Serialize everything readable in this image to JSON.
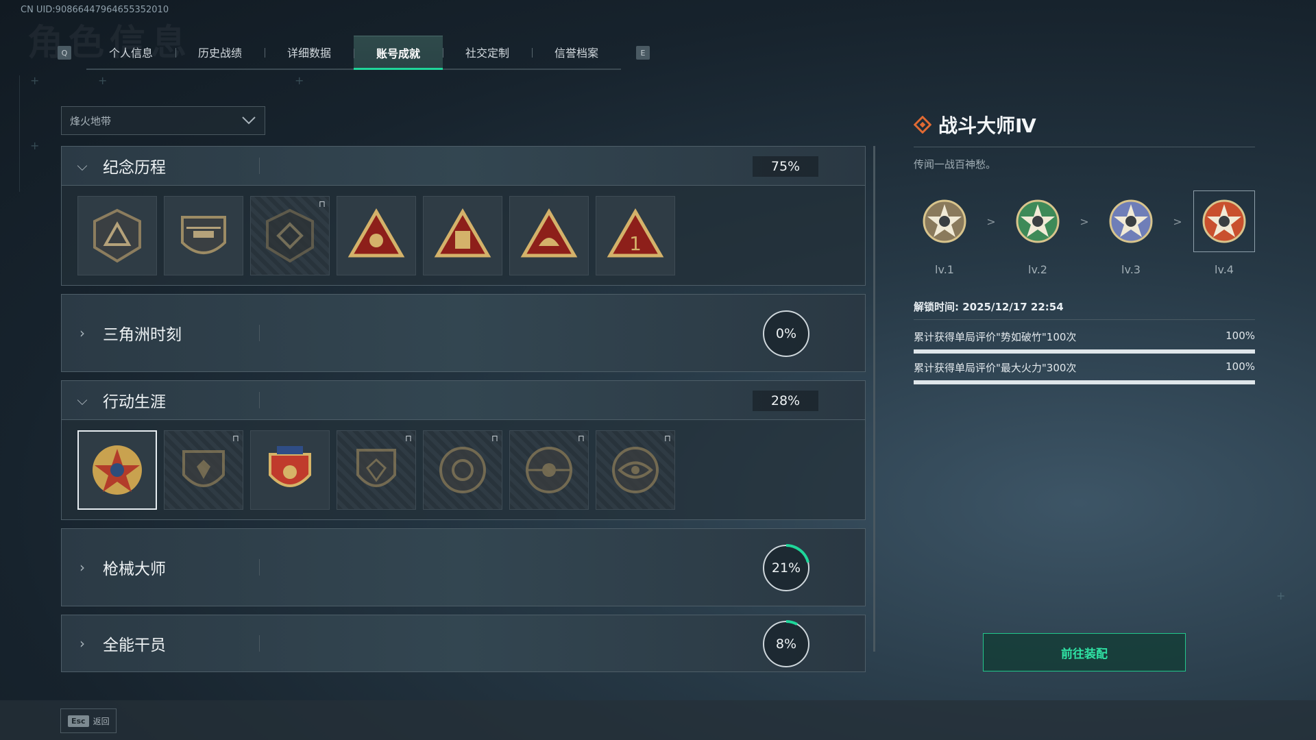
{
  "uid": "CN UID:9086644796465535201​0",
  "bg_title": "角色信息",
  "tabs": {
    "left_key": "Q",
    "right_key": "E",
    "items": [
      "个人信息",
      "历史战绩",
      "详细数据",
      "账号成就",
      "社交定制",
      "信誉档案"
    ],
    "active_index": 3
  },
  "dropdown": {
    "value": "烽火地带"
  },
  "categories": [
    {
      "name": "纪念历程",
      "expanded": true,
      "percent": "75%",
      "progress": 0.75
    },
    {
      "name": "三角洲时刻",
      "expanded": false,
      "percent": "0%",
      "progress": 0
    },
    {
      "name": "行动生涯",
      "expanded": true,
      "percent": "28%",
      "progress": 0.28
    },
    {
      "name": "枪械大师",
      "expanded": false,
      "percent": "21%",
      "progress": 0.21
    },
    {
      "name": "全能干员",
      "expanded": false,
      "percent": "8%",
      "progress": 0.08
    }
  ],
  "memorial_badges": [
    {
      "icon": "triangle-emblem-icon",
      "locked": false
    },
    {
      "icon": "helicopter-emblem-icon",
      "locked": false
    },
    {
      "icon": "shield-emblem-icon",
      "locked": true
    },
    {
      "icon": "radar-triangle-icon",
      "locked": false
    },
    {
      "icon": "document-triangle-icon",
      "locked": false
    },
    {
      "icon": "fist-triangle-icon",
      "locked": false
    },
    {
      "icon": "number-one-triangle-icon",
      "locked": false
    }
  ],
  "career_badges": [
    {
      "icon": "star-skull-medal-icon",
      "locked": false,
      "selected": true
    },
    {
      "icon": "wing-shield-icon",
      "locked": true
    },
    {
      "icon": "eagle-shield-medal-icon",
      "locked": false
    },
    {
      "icon": "gem-shield-icon",
      "locked": true
    },
    {
      "icon": "orb-medal-icon",
      "locked": true
    },
    {
      "icon": "skull-crosshair-medal-icon",
      "locked": true
    },
    {
      "icon": "eye-medal-icon",
      "locked": true
    }
  ],
  "detail": {
    "title": "战斗大师Ⅳ",
    "description": "传闻一战百神愁。",
    "levels": [
      {
        "label": "lv.1",
        "color": "#8a7a5c",
        "current": false
      },
      {
        "label": "lv.2",
        "color": "#3e8a58",
        "current": false
      },
      {
        "label": "lv.3",
        "color": "#6f7eb8",
        "current": false
      },
      {
        "label": "lv.4",
        "color": "#c9502e",
        "current": true
      }
    ],
    "level_separator": ">",
    "unlock_time": "解锁时间: 2025/12/17 22:54",
    "requirements": [
      {
        "text": "累计获得单局评价\"势如破竹\"100次",
        "value": "100%",
        "progress": 1.0
      },
      {
        "text": "累计获得单局评价\"最大火力\"300次",
        "value": "100%",
        "progress": 1.0
      }
    ],
    "equip_button": "前往装配"
  },
  "footer": {
    "esc_key": "Esc",
    "back_label": "返回"
  },
  "colors": {
    "accent": "#1fd69a",
    "title_icon": "#e06a33"
  }
}
